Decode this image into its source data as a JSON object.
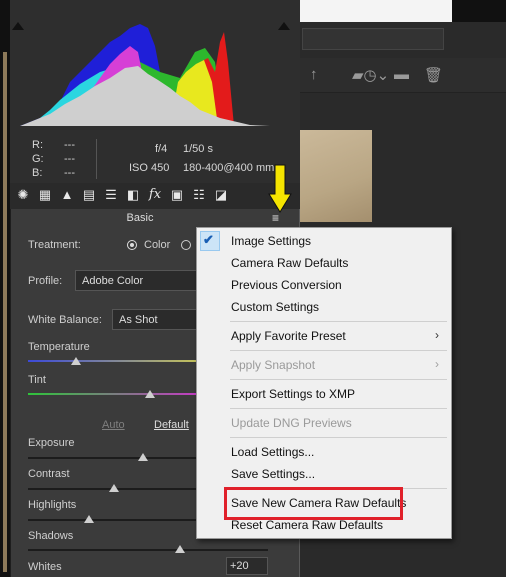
{
  "histogram_info": {
    "r_label": "R:",
    "g_label": "G:",
    "b_label": "B:",
    "r_value": "---",
    "g_value": "---",
    "b_value": "---",
    "aperture": "f/4",
    "shutter": "1/50 s",
    "iso": "ISO 450",
    "lens": "180-400@400 mm"
  },
  "panel": {
    "section_title": "Basic",
    "treatment_label": "Treatment:",
    "treatment_color": "Color",
    "profile_label": "Profile:",
    "profile_value": "Adobe Color",
    "white_balance_label": "White Balance:",
    "white_balance_value": "As Shot",
    "temperature_label": "Temperature",
    "tint_label": "Tint",
    "auto_label": "Auto",
    "default_label": "Default",
    "exposure_label": "Exposure",
    "contrast_label": "Contrast",
    "highlights_label": "Highlights",
    "shadows_label": "Shadows",
    "whites_label": "Whites",
    "whites_value": "+20"
  },
  "menu": {
    "items": [
      {
        "label": "Image Settings",
        "checked": true
      },
      {
        "label": "Camera Raw Defaults"
      },
      {
        "label": "Previous Conversion"
      },
      {
        "label": "Custom Settings"
      },
      {
        "label": "Apply Favorite Preset",
        "submenu": true
      },
      {
        "label": "Apply Snapshot",
        "submenu": true,
        "disabled": true
      },
      {
        "label": "Export Settings to XMP"
      },
      {
        "label": "Update DNG Previews",
        "disabled": true
      },
      {
        "label": "Load Settings..."
      },
      {
        "label": "Save Settings..."
      },
      {
        "label": "Save New Camera Raw Defaults",
        "highlighted": true
      },
      {
        "label": "Reset Camera Raw Defaults"
      }
    ]
  },
  "icons": {
    "menu_trigger": "hamburger-icon",
    "pointer": "yellow-down-arrow",
    "checkmark": "checkmark-icon"
  },
  "colors": {
    "annotation_arrow": "#f5e400",
    "highlight_box": "#e0202a",
    "menu_check": "#1a5fb4"
  }
}
